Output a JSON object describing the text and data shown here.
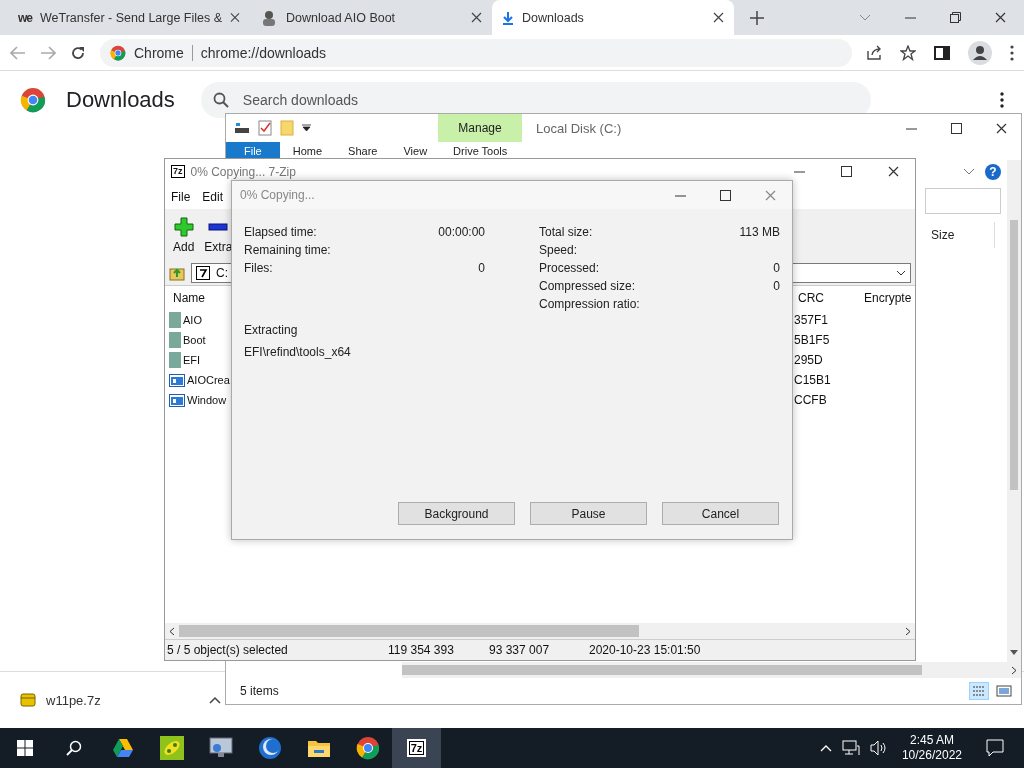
{
  "browser": {
    "tabs": [
      {
        "logo": "we",
        "title": "WeTransfer - Send Large Files &",
        "kind": "site",
        "selected": false
      },
      {
        "title": "Download AIO Boot",
        "kind": "avatar",
        "selected": false
      },
      {
        "title": "Downloads",
        "kind": "download",
        "selected": true
      }
    ],
    "address": {
      "site_label": "Chrome",
      "url": "chrome://downloads"
    }
  },
  "page": {
    "title": "Downloads",
    "search": {
      "placeholder": "Search downloads"
    }
  },
  "download_shelf": {
    "file": "w11pe.7z"
  },
  "explorer": {
    "ribbon_group": "Manage",
    "title": "Local Disk (C:)",
    "ribbon_tabs": [
      {
        "label": "File",
        "selected": true
      },
      {
        "label": "Home",
        "selected": false
      },
      {
        "label": "Share",
        "selected": false
      },
      {
        "label": "View",
        "selected": false
      },
      {
        "label": "Drive Tools",
        "selected": false
      }
    ],
    "help": "?",
    "column": "Size",
    "status": "5 items"
  },
  "zip_window": {
    "logo": "7z",
    "title": "0% Copying... 7-Zip",
    "menu": [
      "File",
      "Edit"
    ],
    "toolbar": [
      {
        "label": "Add",
        "kind": "add"
      },
      {
        "label": "Extra",
        "kind": "extract"
      }
    ],
    "path": "C:",
    "columns": [
      "Name",
      "CRC",
      "Encrypte"
    ],
    "rows": [
      {
        "name": "AIO",
        "kind": "folder",
        "crc": "357F1"
      },
      {
        "name": "Boot",
        "kind": "folder",
        "crc": "5B1F5"
      },
      {
        "name": "EFI",
        "kind": "folder",
        "crc": "295D"
      },
      {
        "name": "AIOCrea",
        "kind": "exe",
        "crc": "C15B1"
      },
      {
        "name": "Window",
        "kind": "exe",
        "crc": "CCFB"
      }
    ],
    "status": [
      "5 / 5 object(s) selected",
      "119 354 393",
      "93 337 007",
      "2020-10-23 15:01:50"
    ]
  },
  "copy_dialog": {
    "title": "0% Copying...",
    "left": [
      {
        "label": "Elapsed time:",
        "value": "00:00:00"
      },
      {
        "label": "Remaining time:"
      },
      {
        "label": "Files:",
        "value": "0"
      }
    ],
    "right": [
      {
        "label": "Total size:",
        "value": "113 MB"
      },
      {
        "label": "Speed:"
      },
      {
        "label": "Processed:",
        "value": "0"
      },
      {
        "label": "Compressed size:",
        "value": "0"
      },
      {
        "label": "Compression ratio:"
      }
    ],
    "operation": "Extracting",
    "current_path": "EFI\\refind\\tools_x64",
    "buttons": [
      "Background",
      "Pause",
      "Cancel"
    ]
  },
  "taskbar": {
    "apps": [
      {
        "kind": "drive",
        "selected": false
      },
      {
        "kind": "green",
        "selected": false
      },
      {
        "kind": "monitor",
        "selected": false
      },
      {
        "kind": "circle",
        "selected": false
      },
      {
        "kind": "folder",
        "selected": false
      },
      {
        "kind": "chrome",
        "selected": false
      },
      {
        "kind": "zip",
        "label": "7z",
        "selected": true
      }
    ],
    "time": "2:45 AM",
    "date": "10/26/2022"
  }
}
